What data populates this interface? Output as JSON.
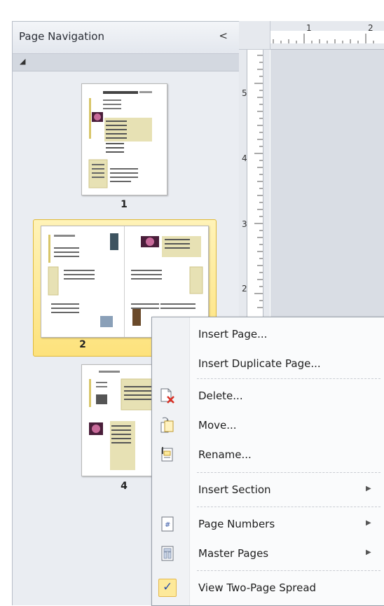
{
  "pane": {
    "title": "Page Navigation",
    "collapse_glyph": "<",
    "section_toggle_glyph": "◢"
  },
  "pages": [
    {
      "number": "1"
    },
    {
      "number": "2",
      "selected": true
    },
    {
      "number": "4"
    }
  ],
  "ruler": {
    "horizontal_labels": [
      "1",
      "2"
    ],
    "vertical_labels": [
      "5",
      "4",
      "3",
      "2"
    ]
  },
  "context_menu": {
    "items": [
      {
        "key": "insert_page",
        "label": "Insert Page...",
        "mnemonic": "P"
      },
      {
        "key": "insert_duplicate_page",
        "label": "Insert Duplicate Page...",
        "mnemonic": "D"
      },
      {
        "key": "delete",
        "label": "Delete...",
        "icon": "delete-page-icon"
      },
      {
        "key": "move",
        "label": "Move...",
        "icon": "move-page-icon"
      },
      {
        "key": "rename",
        "label": "Rename...",
        "icon": "rename-page-icon"
      },
      {
        "key": "insert_section",
        "label": "Insert Section",
        "submenu": true
      },
      {
        "key": "page_numbers",
        "label": "Page Numbers",
        "icon": "page-number-icon",
        "submenu": true
      },
      {
        "key": "master_pages",
        "label": "Master Pages",
        "icon": "master-pages-icon",
        "submenu": true
      },
      {
        "key": "view_two_page_spread",
        "label": "View Two-Page Spread",
        "checked": true
      }
    ],
    "submenu_arrow": "▶",
    "check_glyph": "✓"
  },
  "colors": {
    "selection_fill": "#fde27c",
    "selection_border": "#e0b93a",
    "check_fill": "#fde99a",
    "delete_x": "#d93025"
  }
}
